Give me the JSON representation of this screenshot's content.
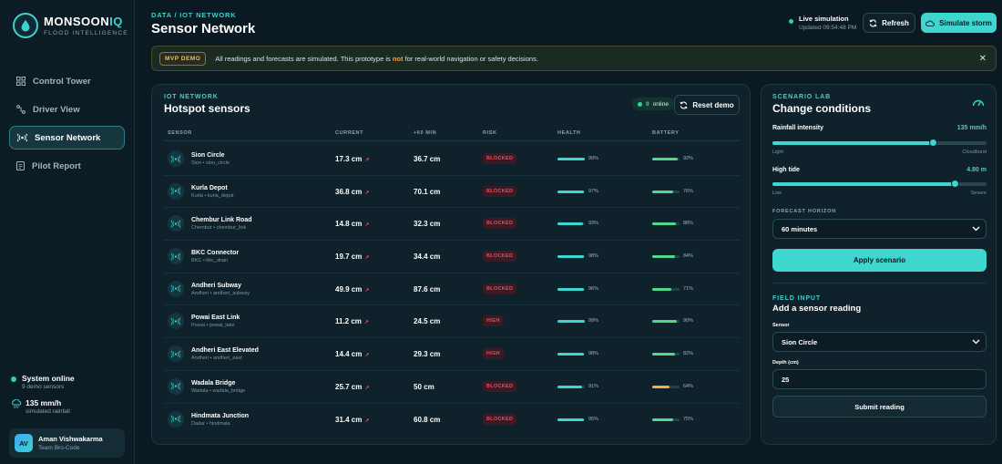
{
  "brand": {
    "name_main": "MONSOON",
    "name_accent": "IQ",
    "subtitle": "FLOOD INTELLIGENCE"
  },
  "nav": [
    {
      "label": "Control Tower",
      "icon": "grid-icon",
      "active": false
    },
    {
      "label": "Driver View",
      "icon": "route-icon",
      "active": false
    },
    {
      "label": "Sensor Network",
      "icon": "sensor-icon",
      "active": true
    },
    {
      "label": "Pilot Report",
      "icon": "report-icon",
      "active": false
    }
  ],
  "system": {
    "status": "System online",
    "sensors": "9 demo sensors",
    "rainfall": "135 mm/h",
    "rainfall_sub": "simulated rainfall"
  },
  "user": {
    "initials": "AV",
    "name": "Aman Vishwakarma",
    "team": "Team Bro-Code"
  },
  "header": {
    "breadcrumb": "DATA / IOT NETWORK",
    "title": "Sensor Network"
  },
  "live": {
    "title": "Live simulation",
    "updated": "Updated 09:54:48 PM"
  },
  "actions": {
    "refresh": "Refresh",
    "storm": "Simulate storm"
  },
  "banner": {
    "tag": "MVP DEMO",
    "text_before": "All readings and forecasts are simulated. This prototype is ",
    "text_strong": "not",
    "text_after": " for real-world navigation or safety decisions."
  },
  "sensors_panel": {
    "label": "IOT NETWORK",
    "title": "Hotspot sensors",
    "online_count": "9",
    "online_label": "online",
    "reset": "Reset demo",
    "columns": [
      "SENSOR",
      "CURRENT",
      "+60 MIN",
      "RISK",
      "HEALTH",
      "BATTERY"
    ],
    "rows": [
      {
        "name": "Sion Circle",
        "sub": "Sion • sion_circle",
        "current": "17.3 cm",
        "forecast": "36.7 cm",
        "risk": "BLOCKED",
        "health": 99,
        "health_label": "99%",
        "battery": 92,
        "battery_label": "92%"
      },
      {
        "name": "Kurla Depot",
        "sub": "Kurla • kurla_depot",
        "current": "36.8 cm",
        "forecast": "70.1 cm",
        "risk": "BLOCKED",
        "health": 97,
        "health_label": "97%",
        "battery": 76,
        "battery_label": "76%"
      },
      {
        "name": "Chembur Link Road",
        "sub": "Chembur • chembur_link",
        "current": "14.8 cm",
        "forecast": "32.3 cm",
        "risk": "BLOCKED",
        "health": 93,
        "health_label": "93%",
        "battery": 88,
        "battery_label": "88%"
      },
      {
        "name": "BKC Connector",
        "sub": "BKC • bkc_drain",
        "current": "19.7 cm",
        "forecast": "34.4 cm",
        "risk": "BLOCKED",
        "health": 98,
        "health_label": "98%",
        "battery": 84,
        "battery_label": "84%"
      },
      {
        "name": "Andheri Subway",
        "sub": "Andheri • andheri_subway",
        "current": "49.9 cm",
        "forecast": "87.6 cm",
        "risk": "BLOCKED",
        "health": 96,
        "health_label": "96%",
        "battery": 71,
        "battery_label": "71%"
      },
      {
        "name": "Powai East Link",
        "sub": "Powai • powai_lake",
        "current": "11.2 cm",
        "forecast": "24.5 cm",
        "risk": "HIGH",
        "health": 99,
        "health_label": "99%",
        "battery": 90,
        "battery_label": "90%"
      },
      {
        "name": "Andheri East Elevated",
        "sub": "Andheri • andheri_east",
        "current": "14.4 cm",
        "forecast": "29.3 cm",
        "risk": "HIGH",
        "health": 98,
        "health_label": "98%",
        "battery": 82,
        "battery_label": "82%"
      },
      {
        "name": "Wadala Bridge",
        "sub": "Wadala • wadala_bridge",
        "current": "25.7 cm",
        "forecast": "50 cm",
        "risk": "BLOCKED",
        "health": 91,
        "health_label": "91%",
        "battery": 64,
        "battery_label": "64%"
      },
      {
        "name": "Hindmata Junction",
        "sub": "Dadar • hindmata",
        "current": "31.4 cm",
        "forecast": "60.8 cm",
        "risk": "BLOCKED",
        "health": 95,
        "health_label": "95%",
        "battery": 75,
        "battery_label": "75%"
      }
    ]
  },
  "scenario": {
    "label": "SCENARIO LAB",
    "title": "Change conditions",
    "rain_label": "Rainfall intensity",
    "rain_value": "135 mm/h",
    "rain_level": 0.75,
    "rain_min": "Light",
    "rain_max": "Cloudburst",
    "tide_label": "High tide",
    "tide_value": "4.80 m",
    "tide_level": 0.85,
    "tide_min": "Low",
    "tide_max": "Severe",
    "horizon_label": "FORECAST HORIZON",
    "horizon_value": "60 minutes",
    "apply": "Apply scenario"
  },
  "field_input": {
    "label": "FIELD INPUT",
    "title": "Add a sensor reading",
    "sensor_label": "Sensor",
    "sensor_value": "Sion Circle",
    "depth_label": "Depth (cm)",
    "depth_value": "25",
    "submit": "Submit reading"
  },
  "colors": {
    "accent": "#3fd6d0",
    "blocked": "#f04a5a",
    "high": "#f04a5a",
    "battery_ok": "#4fd88a",
    "battery_warn": "#f0b045",
    "online": "#2fd3a0"
  }
}
